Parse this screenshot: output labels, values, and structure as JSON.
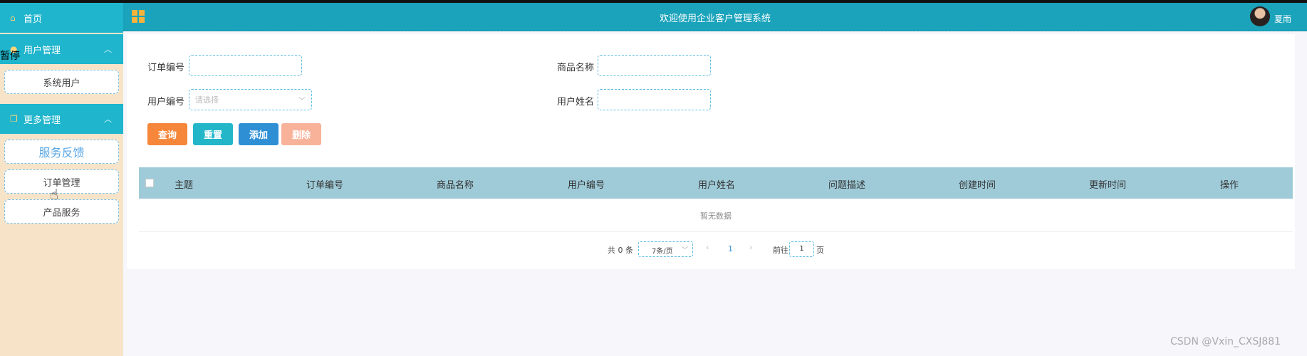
{
  "sidebar": {
    "home_label": "首页",
    "user_mgmt_label": "用户管理",
    "user_items": [
      "系统用户"
    ],
    "more_mgmt_label": "更多管理",
    "more_items": [
      "服务反馈",
      "订单管理",
      "产品服务"
    ]
  },
  "overlay": {
    "pause_label": "暂停"
  },
  "header": {
    "title": "欢迎使用企业客户管理系统",
    "username": "夏雨"
  },
  "form": {
    "order_no_label": "订单编号",
    "product_name_label": "商品名称",
    "user_no_label": "用户编号",
    "user_no_placeholder": "请选择",
    "user_name_label": "用户姓名"
  },
  "buttons": {
    "query": "查询",
    "reset": "重置",
    "add": "添加",
    "delete": "删除"
  },
  "table": {
    "columns": [
      "主题",
      "订单编号",
      "商品名称",
      "用户编号",
      "用户姓名",
      "问题描述",
      "创建时间",
      "更新时间",
      "操作"
    ],
    "empty_text": "暂无数据"
  },
  "pagination": {
    "total_text": "共 0 条",
    "page_size": "7条/页",
    "current_page": "1",
    "goto_label": "前往",
    "goto_value": "1",
    "page_suffix": "页"
  },
  "watermark": "CSDN @Vxin_CXSJ881",
  "colors": {
    "accent": "#1aa3bb",
    "sidebar_bg": "#f7e4c8",
    "query_btn": "#f5863a",
    "reset_btn": "#23b6c9",
    "add_btn": "#2e8fd5",
    "delete_btn": "#f8b29a",
    "table_header": "#9fcbd8"
  }
}
